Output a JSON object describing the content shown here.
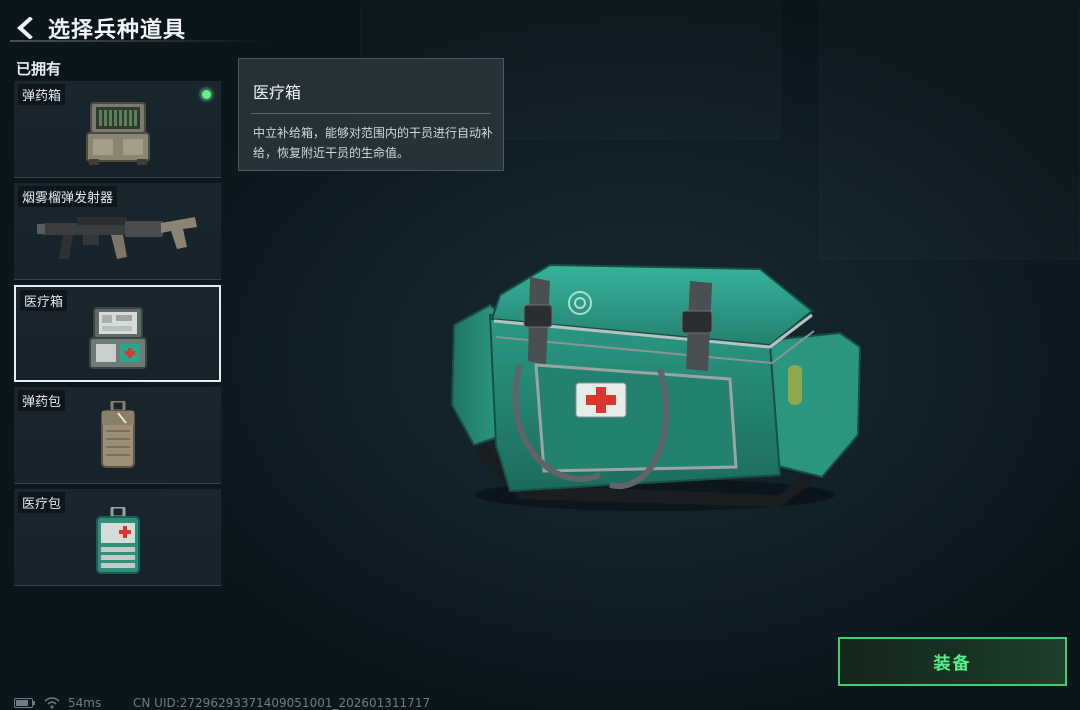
{
  "header": {
    "title": "选择兵种道具"
  },
  "owned_label": "已拥有",
  "items": [
    {
      "name": "弹药箱",
      "equipped": true
    },
    {
      "name": "烟雾榴弹发射器",
      "equipped": false
    },
    {
      "name": "医疗箱",
      "equipped": false,
      "selected": true
    },
    {
      "name": "弹药包",
      "equipped": false
    },
    {
      "name": "医疗包",
      "equipped": false
    }
  ],
  "tooltip": {
    "title": "医疗箱",
    "description": "中立补给箱，能够对范围内的干员进行自动补给，恢复附近干员的生命值。"
  },
  "equip_button": {
    "label": "装备"
  },
  "status": {
    "ping": "54ms",
    "uid": "CN UID:27296293371409051001_202601311717"
  },
  "colors": {
    "accent_green": "#56f08a",
    "equipped_dot": "#5ef08d",
    "medkit_teal": "#2aa58c"
  }
}
